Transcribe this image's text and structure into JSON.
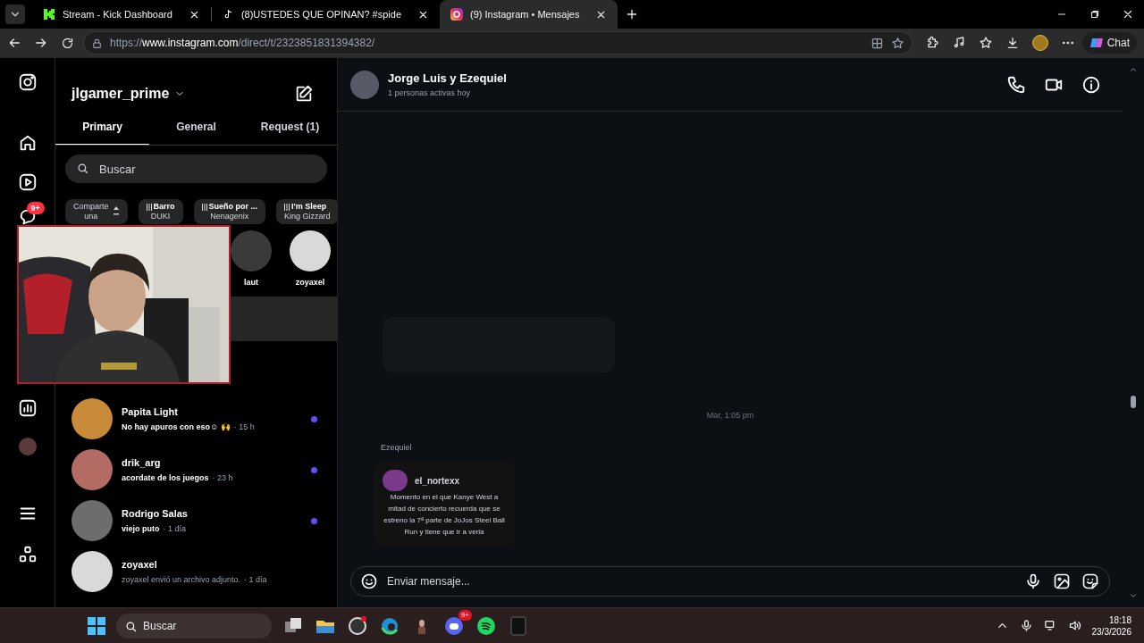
{
  "browser": {
    "tabs": [
      {
        "title": "Stream - Kick Dashboard",
        "kind": "kick",
        "selected": false
      },
      {
        "title": "(8)USTEDES QUE OPINAN? #spide",
        "kind": "tiktok",
        "selected": false
      },
      {
        "title": "(9) Instagram • Mensajes",
        "kind": "instagram",
        "selected": true
      }
    ],
    "url_prefix": "https://",
    "url_host": "www.instagram.com",
    "url_path": "/direct/t/2323851831394382/",
    "chat_button": "Chat"
  },
  "nav": {
    "messages_badge": "9+"
  },
  "inbox": {
    "account": "jlgamer_prime",
    "tabs": [
      {
        "label": "Primary",
        "selected": true
      },
      {
        "label": "General",
        "selected": false
      },
      {
        "label": "Request (1)",
        "selected": false
      }
    ],
    "search": {
      "placeholder": "Buscar"
    },
    "notes": [
      {
        "line1": "Comparte",
        "line2": "una",
        "kind": "share"
      },
      {
        "line1": "Barro",
        "line2": "DUKI",
        "kind": "song"
      },
      {
        "line1": "Sueño por ...",
        "line2": "Nenagenix",
        "kind": "song"
      },
      {
        "line1": "I'm Sleep",
        "line2": "King Gizzard",
        "kind": "song"
      }
    ],
    "note_people": [
      {
        "name": "laut",
        "color": "#3a3a3a"
      },
      {
        "name": "zoyaxel",
        "color": "#d9d9d9"
      }
    ],
    "conversations": [
      {
        "name": "Papita Light",
        "preview": "No hay apuros con eso☺ 🙌",
        "time": "· 15 h",
        "unread": true,
        "color": "#c98a3a"
      },
      {
        "name": "drik_arg",
        "preview": "acordate de los juegos",
        "time": "· 23 h",
        "unread": true,
        "color": "#b46b63"
      },
      {
        "name": "Rodrigo Salas",
        "preview": "viejo puto",
        "time": "· 1 día",
        "unread": true,
        "color": "#6b6e6a"
      },
      {
        "name": "zoyaxel",
        "preview": "zoyaxel envió un archivo adjunto.",
        "time": "· 1 día",
        "unread": false,
        "color": "#d9d9d9"
      }
    ]
  },
  "chat": {
    "title": "Jorge Luis y Ezequiel",
    "status": "1 personas activas hoy",
    "timestamp": "Mar, 1:05 pm",
    "sender": "Ezequiel",
    "shared_post": {
      "author": "el_nortexx",
      "caption": "Momento en el que Kanye West a mitad de concierto recuerda que se estreno la 7ª parte de JoJos Steel Ball Run y tiene que ir a verla"
    },
    "input": {
      "placeholder": "Enviar mensaje..."
    }
  },
  "taskbar": {
    "search": {
      "placeholder": "Buscar"
    },
    "discord_badge": "9+",
    "time": "18:18",
    "date": "23/3/2026"
  }
}
